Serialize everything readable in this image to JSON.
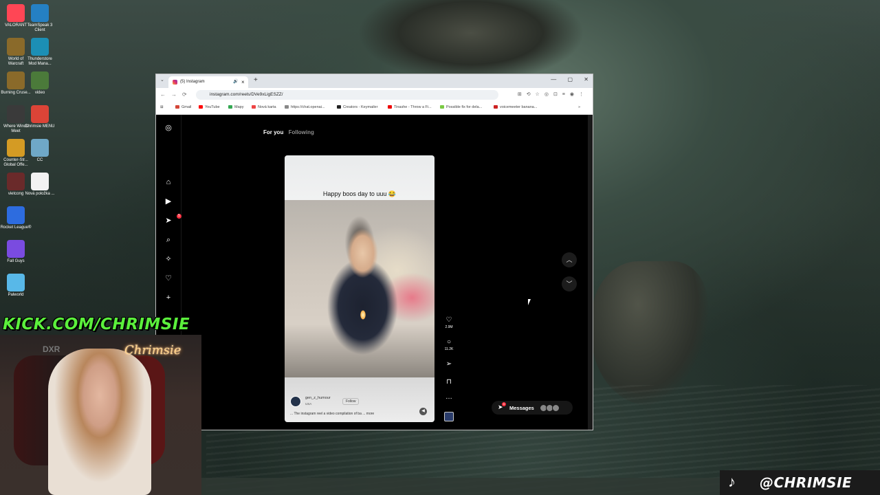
{
  "desktop": {
    "icons": [
      {
        "label": "VALORANT",
        "icon": "valorant-icon",
        "color": "#ff4655"
      },
      {
        "label": "TeamSpeak 3 Client",
        "icon": "teamspeak-icon",
        "color": "#2580c3"
      },
      {
        "label": "World of Warcraft",
        "icon": "warcraft-icon",
        "color": "#8a6a2a"
      },
      {
        "label": "Thunderstore Mod Mana...",
        "icon": "thunderstore-icon",
        "color": "#1c8fb5"
      },
      {
        "label": "Burning Cruse...",
        "icon": "warcraft-icon",
        "color": "#8a6a2a"
      },
      {
        "label": "video",
        "icon": "video-file-icon",
        "color": "#4b7a3a"
      },
      {
        "label": "Where Winds Meet",
        "icon": "game-icon",
        "color": "#3a3a3a"
      },
      {
        "label": "Chrimsie MENU",
        "icon": "chrome-icon",
        "color": "#db4437"
      },
      {
        "label": "Counter-Str... Global Offe...",
        "icon": "csgo-icon",
        "color": "#d49b24"
      },
      {
        "label": "CC",
        "icon": "image-icon",
        "color": "#6fa8c7"
      },
      {
        "label": "vietcong",
        "icon": "game-icon",
        "color": "#6a2a2a"
      },
      {
        "label": "Nová položka ...",
        "icon": "document-icon",
        "color": "#f2f2f2"
      },
      {
        "label": "Rocket League®",
        "icon": "rocket-league-icon",
        "color": "#2d6cdf"
      },
      {
        "label": "Fall Guys",
        "icon": "fall-guys-icon",
        "color": "#7a4be0"
      },
      {
        "label": "Palworld",
        "icon": "palworld-icon",
        "color": "#58b8e8"
      }
    ]
  },
  "overlay": {
    "kick_text": "KICK.COM/CHRIMSIE",
    "neon_sign": "Chrimsie",
    "chair_brand": "DXR",
    "tiktok_handle": "@CHRIMSIE"
  },
  "browser": {
    "tab_title": "(5) Instagram",
    "url": "instagram.com/reels/DVe9xLigESZZ/",
    "bookmarks": [
      "Gmail",
      "YouTube",
      "Mapy",
      "Nová karta",
      "https://chat.openai...",
      "Creators - Keymailer",
      "Tinashe - Throw a Fi...",
      "Possible fix for dela...",
      "voicemeeter banana..."
    ]
  },
  "instagram": {
    "rail_badge": "5",
    "tabs": {
      "for_you": "For you",
      "following": "Following"
    },
    "reel": {
      "caption": "Happy boos day to uuu 😂",
      "username": "gen_z_humour",
      "location": "USA",
      "follow_label": "Follow",
      "description": "... The instagram reel a video compilation of ba",
      "more": "... more"
    },
    "actions": {
      "likes": "2.9M",
      "comments": "11.2K"
    },
    "messages": {
      "label": "Messages",
      "badge": "5"
    }
  }
}
